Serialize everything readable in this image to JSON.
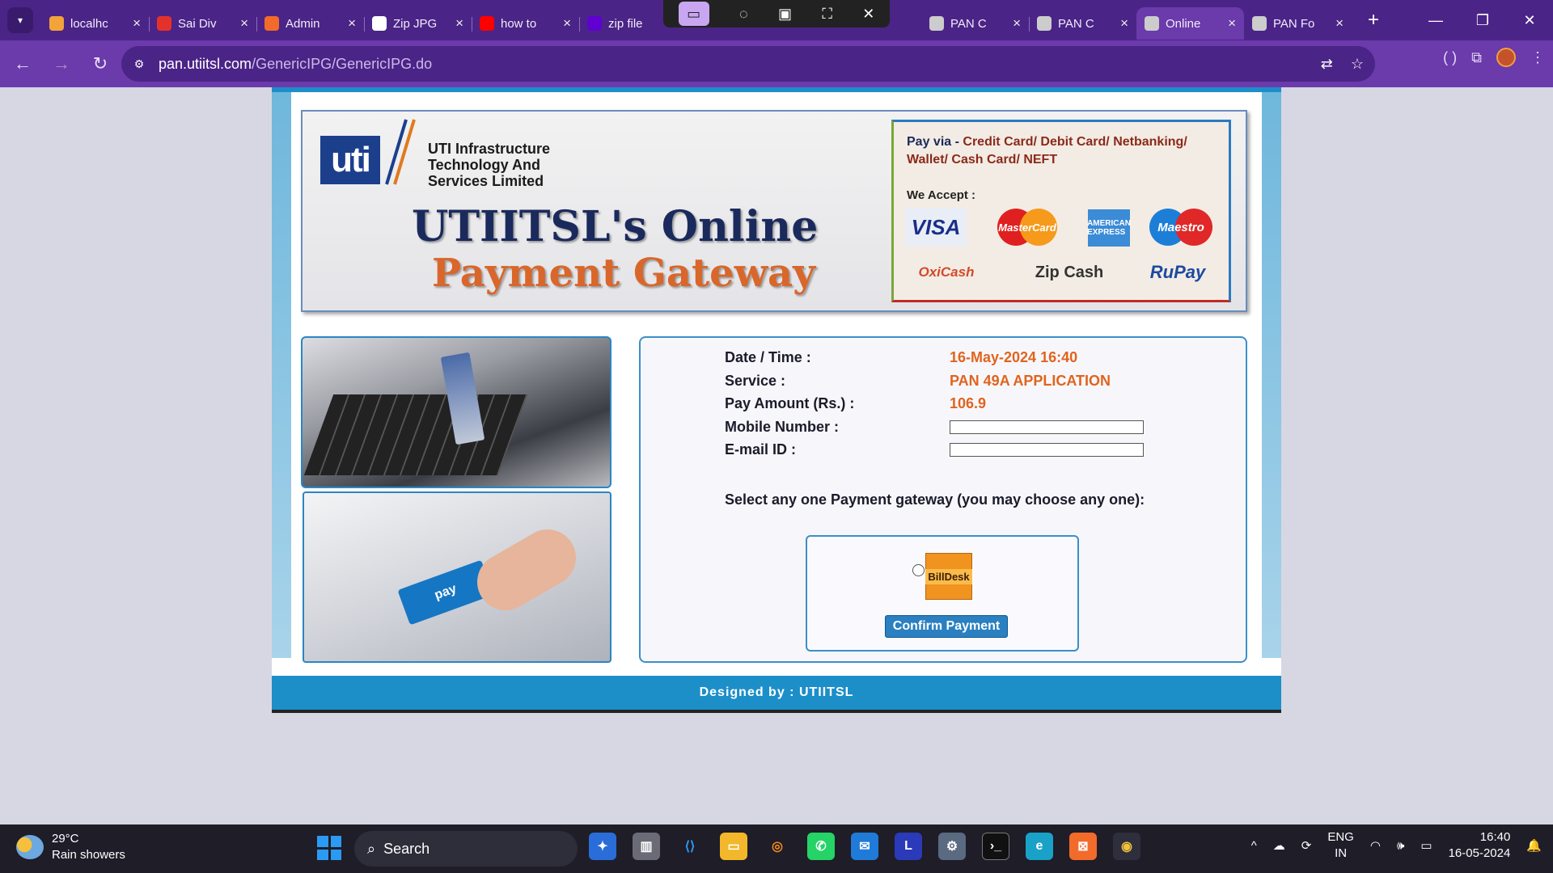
{
  "browser": {
    "tabs": [
      {
        "label": "localhc",
        "icon": "xampp-icon",
        "color": "#f2a33a"
      },
      {
        "label": "Sai Div",
        "icon": "flag-icon",
        "color": "#e4322b"
      },
      {
        "label": "Admin",
        "icon": "admin-icon",
        "color": "#f26b2b"
      },
      {
        "label": "Zip JPG",
        "icon": "openai-icon",
        "color": "#ffffff"
      },
      {
        "label": "how to",
        "icon": "youtube-icon",
        "color": "#ff0000"
      },
      {
        "label": "zip file",
        "icon": "yahoo-icon",
        "color": "#6001d2"
      },
      {
        "label": "PAN C",
        "icon": "globe-icon",
        "color": "#cccccc"
      },
      {
        "label": "PAN C",
        "icon": "globe-icon",
        "color": "#cccccc"
      },
      {
        "label": "Online",
        "icon": "globe-icon",
        "color": "#cccccc",
        "active": true
      },
      {
        "label": "PAN Fo",
        "icon": "globe-icon",
        "color": "#cccccc"
      }
    ],
    "url_host": "pan.utiitsl.com",
    "url_path": "/GenericIPG/GenericIPG.do"
  },
  "header": {
    "logo_text": "uti",
    "company": [
      "UTI Infrastructure",
      "Technology And",
      "Services Limited"
    ],
    "title_line1": "UTIITSL's Online",
    "title_line2": "Payment Gateway",
    "pay_via_label": "Pay via -",
    "pay_via_methods": "Credit Card/ Debit Card/ Netbanking/ Wallet/ Cash Card/ NEFT",
    "we_accept": "We Accept :",
    "cards": {
      "visa": "VISA",
      "mastercard": "MasterCard",
      "amex": "AMERICAN EXPRESS",
      "maestro": "Maestro",
      "oxicash": "OxiCash",
      "zipcash": "Zip Cash",
      "rupay": "RuPay"
    }
  },
  "form": {
    "datetime_label": "Date / Time :",
    "datetime_value": "16-May-2024 16:40",
    "service_label": "Service :",
    "service_value": "PAN 49A APPLICATION",
    "amount_label": "Pay Amount (Rs.) :",
    "amount_value": "106.9",
    "mobile_label": "Mobile Number :",
    "mobile_value": "",
    "email_label": "E-mail ID :",
    "email_value": "",
    "select_prompt": "Select any one Payment gateway (you may choose any one):",
    "gateway_name": "BillDesk",
    "confirm_label": "Confirm Payment"
  },
  "images": {
    "pay_key_text": "pay"
  },
  "footer": {
    "text": "Designed by : UTIITSL"
  },
  "taskbar": {
    "temperature": "29°C",
    "weather": "Rain showers",
    "search_placeholder": "Search",
    "lang_top": "ENG",
    "lang_bottom": "IN",
    "time": "16:40",
    "date": "16-05-2024"
  }
}
